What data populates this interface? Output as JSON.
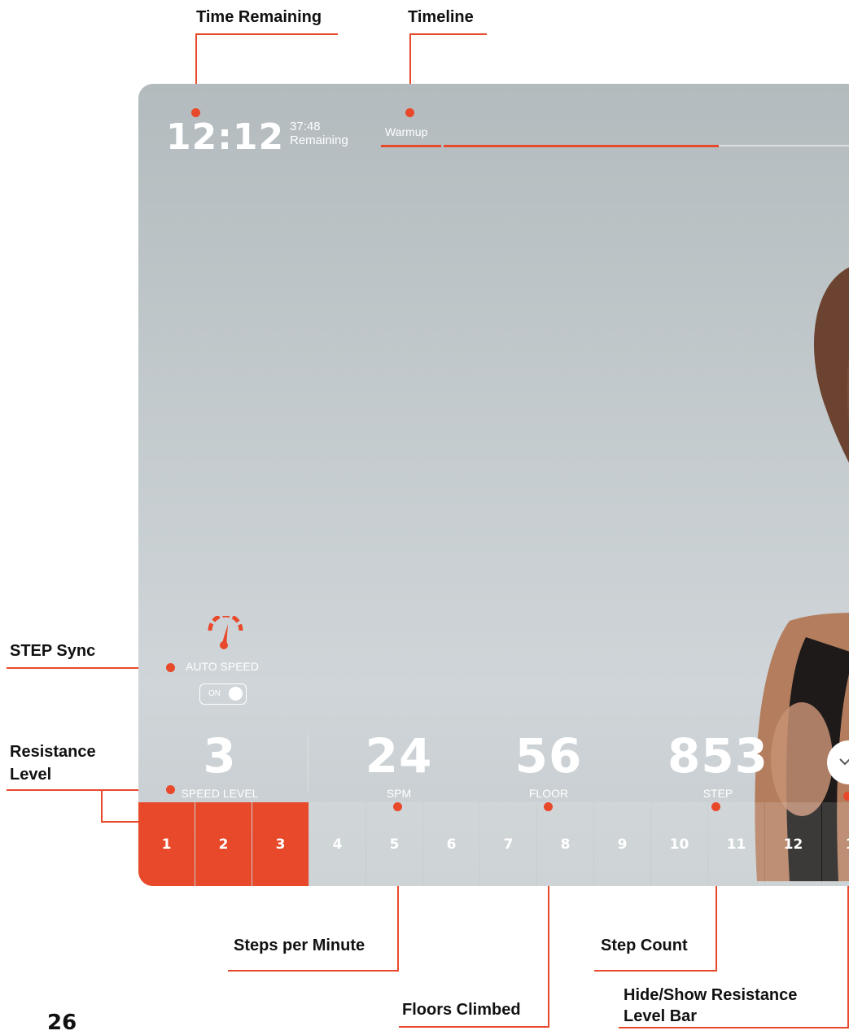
{
  "callouts": {
    "time_remaining": "Time Remaining",
    "timeline": "Timeline",
    "step_sync": "STEP Sync",
    "resistance_level_1": "Resistance",
    "resistance_level_2": "Level",
    "steps_per_minute": "Steps per Minute",
    "step_count": "Step Count",
    "floors_climbed": "Floors Climbed",
    "hide_show_1": "Hide/Show Resistance",
    "hide_show_2": "Level Bar"
  },
  "screen": {
    "clock": "12:12",
    "remaining_time": "37:48",
    "remaining_label": "Remaining",
    "segment_label": "Warmup",
    "timeline_progress": 0.72,
    "auto_speed_label": "AUTO SPEED",
    "auto_speed_state": "ON",
    "metrics": {
      "speed_level": {
        "value": "3",
        "label": "SPEED LEVEL"
      },
      "spm": {
        "value": "24",
        "label": "SPM"
      },
      "floor": {
        "value": "56",
        "label": "FLOOR"
      },
      "step": {
        "value": "853",
        "label": "STEP"
      }
    },
    "resistance_levels": [
      "1",
      "2",
      "3",
      "4",
      "5",
      "6",
      "7",
      "8",
      "9",
      "10",
      "11",
      "12",
      "1"
    ],
    "active_level": 3
  },
  "page_number": "26",
  "colors": {
    "accent": "#e8492a",
    "screen_bg": "#c3cacd"
  }
}
